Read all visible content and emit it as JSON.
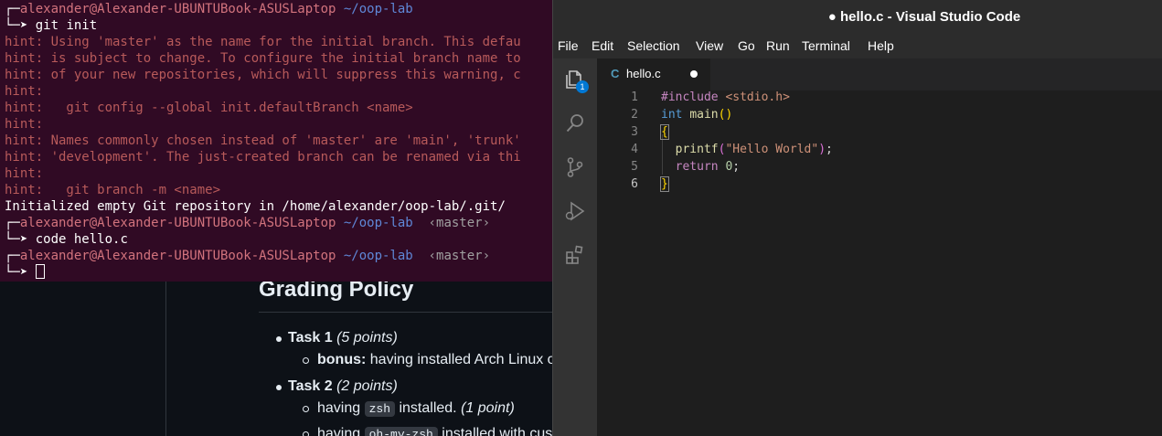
{
  "background_page": {
    "heading": "Grading Policy",
    "task1_title": "Task 1",
    "task1_points": "(5 points)",
    "bonus_label": "bonus:",
    "bonus_text": "having installed Arch Linux o",
    "task2_title": "Task 2",
    "task2_points": "(2 points)",
    "having_1": "having",
    "zsh_code": "zsh",
    "installed_1": "installed.",
    "one_point": "(1 point)",
    "having_2": "having",
    "ohmyzsh_code": "oh-my-zsh",
    "installed_2": "installed with cus"
  },
  "terminal": {
    "prompt_box_top": "┌─",
    "prompt_box_bottom": "└─➤",
    "user_host": "alexander@Alexander-UBUNTUBook-ASUSLaptop",
    "path": "~/oop-lab",
    "branch": "‹master›",
    "cmd1": "git init",
    "hint1": "hint: Using 'master' as the name for the initial branch. This defau",
    "hint2": "hint: is subject to change. To configure the initial branch name to",
    "hint3": "hint: of your new repositories, which will suppress this warning, c",
    "hint4": "hint:",
    "hint5": "hint:   git config --global init.defaultBranch <name>",
    "hint6": "hint:",
    "hint7": "hint: Names commonly chosen instead of 'master' are 'main', 'trunk'",
    "hint8": "hint: 'development'. The just-created branch can be renamed via thi",
    "hint9": "hint:",
    "hint10": "hint:   git branch -m <name>",
    "init_msg": "Initialized empty Git repository in /home/alexander/oop-lab/.git/",
    "cmd2": "code hello.c"
  },
  "vscode": {
    "title": "● hello.c - Visual Studio Code",
    "menu": [
      "File",
      "Edit",
      "Selection",
      "View",
      "Go",
      "Run",
      "Terminal",
      "Help"
    ],
    "explorer_badge": "1",
    "tab_lang_icon": "C",
    "tab_name": "hello.c",
    "line_numbers": [
      "1",
      "2",
      "3",
      "4",
      "5",
      "6"
    ],
    "code": {
      "l1_include": "#include",
      "l1_header": "<stdio.h>",
      "l2_type": "int",
      "l2_fn": "main",
      "l2_parens": "()",
      "l3_brace": "{",
      "l4_fn": "printf",
      "l4_open": "(",
      "l4_str": "\"Hello World\"",
      "l4_close": ")",
      "l4_semi": ";",
      "l5_kw": "return",
      "l5_num": "0",
      "l5_semi": ";",
      "l6_brace": "}"
    },
    "icons": [
      "files-icon",
      "search-icon",
      "source-control-icon",
      "run-debug-icon",
      "extensions-icon"
    ]
  },
  "colors": {
    "terminal_bg": "#300a24",
    "vscode_bg": "#1e1e1e",
    "accent_badge": "#0078d4"
  }
}
